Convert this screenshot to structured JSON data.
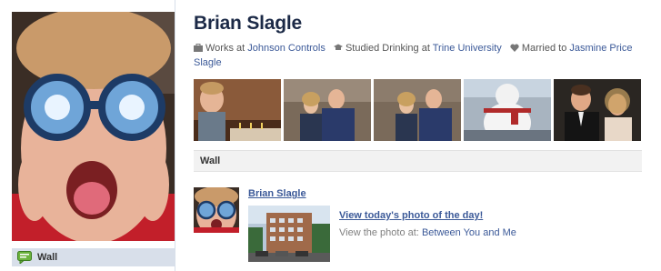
{
  "profile": {
    "name": "Brian Slagle",
    "works_prefix": "Works at",
    "works_link": "Johnson Controls",
    "studied_prefix": "Studied Drinking at",
    "studied_link": "Trine University",
    "married_prefix": "Married to",
    "married_link": "Jasmine Price Slagle"
  },
  "left_nav": {
    "wall_label": "Wall"
  },
  "wall_section": {
    "title": "Wall"
  },
  "story": {
    "author": "Brian Slagle",
    "link_title": "View today's photo of the day!",
    "sub_prefix": "View the photo at:",
    "sub_link": "Between You and Me"
  },
  "colors": {
    "link": "#3b5998",
    "name": "#1c2a47",
    "nav_bg": "#d8dfea"
  },
  "icons": [
    "briefcase-icon",
    "graduation-cap-icon",
    "heart-icon",
    "wall-icon"
  ]
}
